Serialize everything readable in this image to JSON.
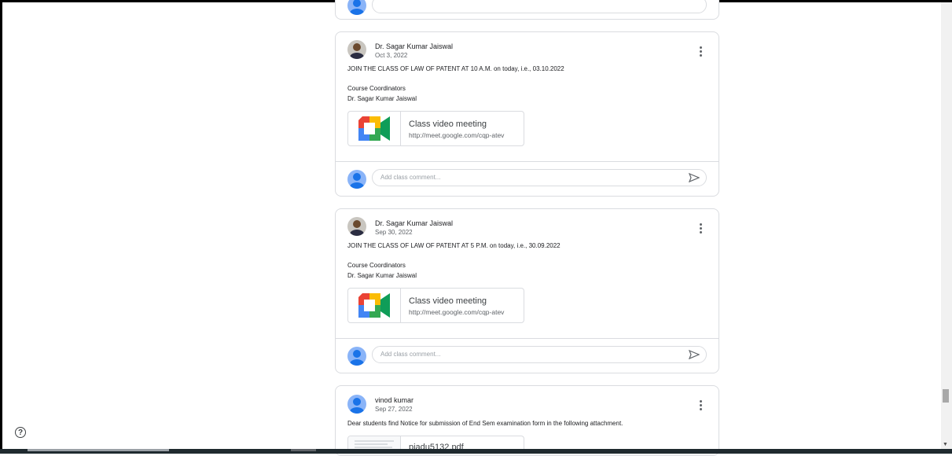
{
  "posts": [
    {
      "author": "Dr. Sagar Kumar Jaiswal",
      "date": "Oct 3, 2022",
      "line1": "JOIN THE CLASS OF LAW OF PATENT AT 10 A.M. on today, i.e., 03.10.2022",
      "line2": "Course Coordinators",
      "line3": "Dr. Sagar Kumar Jaiswal",
      "meet_title": "Class video meeting",
      "meet_link": "http://meet.google.com/cqp-atev",
      "comment_placeholder": "Add class comment..."
    },
    {
      "author": "Dr. Sagar Kumar Jaiswal",
      "date": "Sep 30, 2022",
      "line1": "JOIN THE CLASS OF LAW OF PATENT AT 5 P.M. on today, i.e., 30.09.2022",
      "line2": "Course Coordinators",
      "line3": "Dr. Sagar Kumar Jaiswal",
      "meet_title": "Class video meeting",
      "meet_link": "http://meet.google.com/cqp-atev",
      "comment_placeholder": "Add class comment..."
    },
    {
      "author": "vinod kumar",
      "date": "Sep 27, 2022",
      "line1": "Dear students find Notice for submission of End Sem examination form in the following attachment.",
      "attachment_name": "pjadu5132.pdf"
    }
  ],
  "icons": {
    "help": "question-circle-icon",
    "send": "send-icon",
    "more": "more-vert-icon",
    "meet": "google-meet-icon"
  },
  "help_glyph": "?"
}
